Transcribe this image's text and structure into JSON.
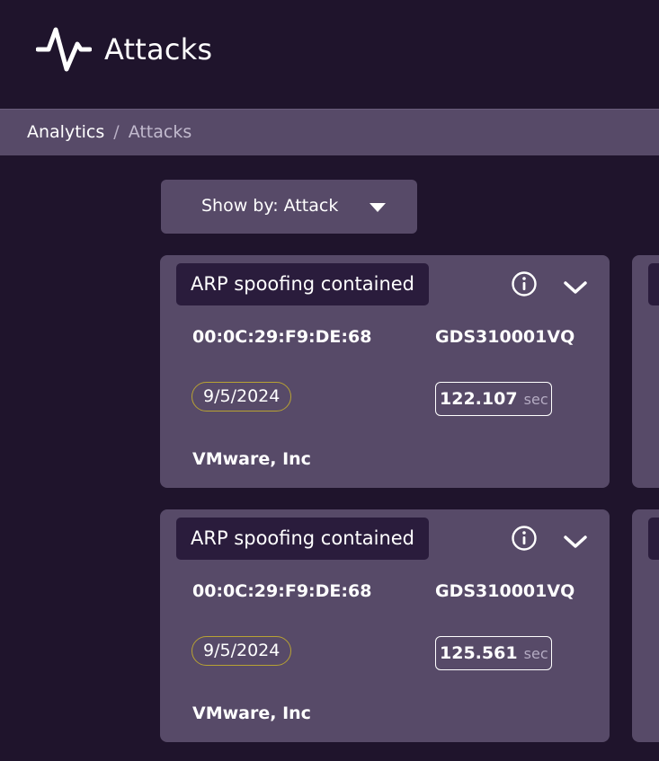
{
  "header": {
    "title": "Attacks",
    "icon": "activity-pulse-icon"
  },
  "breadcrumb": {
    "items": [
      {
        "label": "Analytics"
      },
      {
        "label": "Attacks"
      }
    ],
    "separator": "/"
  },
  "toolbar": {
    "show_by_label": "Show by: Attack"
  },
  "colors": {
    "background": "#1f142c",
    "panel": "#574a68",
    "tag_background": "#2a1c3c",
    "date_outline": "#b8a233"
  },
  "cards": [
    {
      "title": "ARP spoofing contained",
      "mac": "00:0C:29:F9:DE:68",
      "serial": "GDS310001VQ",
      "date": "9/5/2024",
      "duration_value": "122.107",
      "duration_unit": "sec",
      "vendor": "VMware, Inc"
    },
    {
      "title": "ARP spoofing contained",
      "mac": "00:0C:29:F9:DE:68",
      "serial": "GDS310001VQ",
      "date": "9/5/2024",
      "duration_value": "125.561",
      "duration_unit": "sec",
      "vendor": "VMware, Inc"
    }
  ]
}
